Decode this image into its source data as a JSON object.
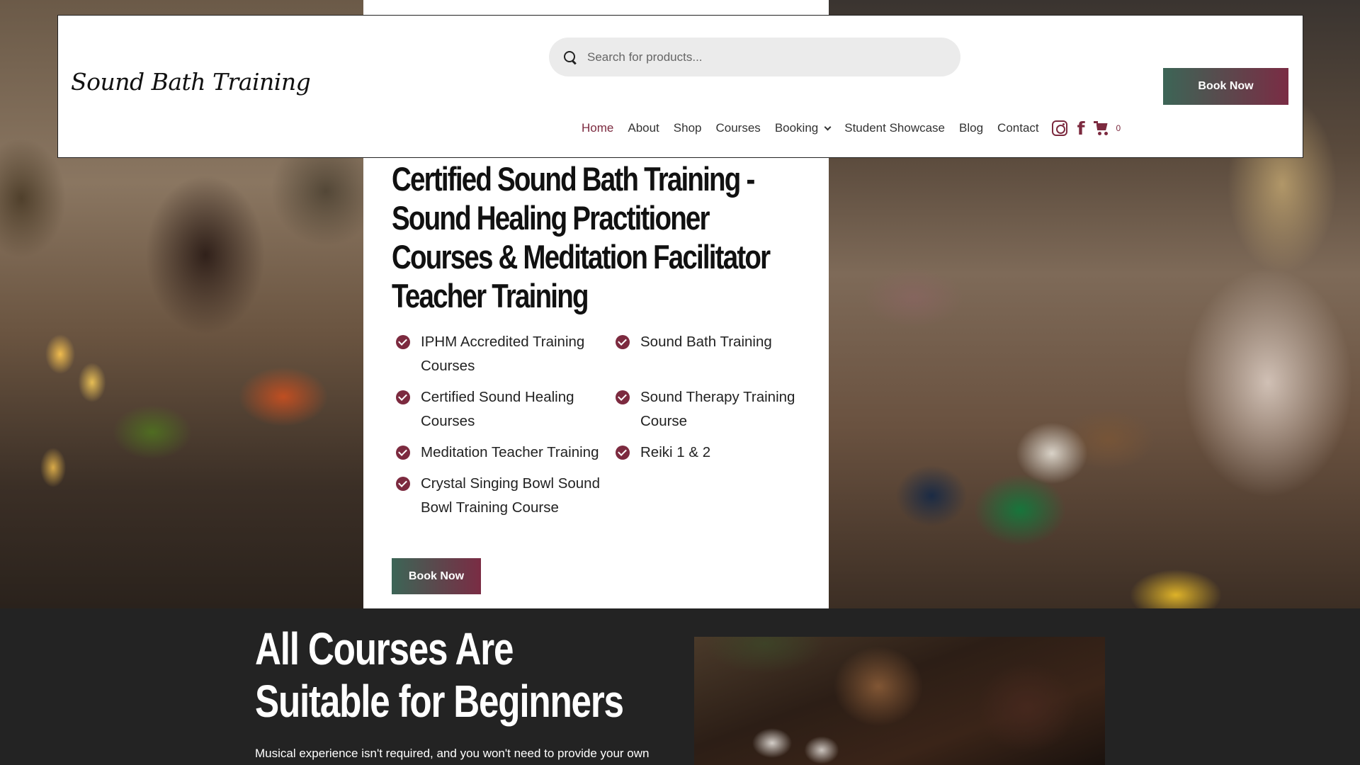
{
  "header": {
    "logo": "Sound Bath Training",
    "search_placeholder": "Search for products...",
    "book_now": "Book Now",
    "nav": [
      "Home",
      "About",
      "Shop",
      "Courses",
      "Booking",
      "Student Showcase",
      "Blog",
      "Contact"
    ],
    "cart_count": "0"
  },
  "hero": {
    "title": "Certified Sound Bath Training - Sound Healing Practitioner Courses & Meditation Facilitator Teacher Training",
    "features_left": [
      "IPHM Accredited Training Courses",
      "Certified Sound Healing Courses",
      "Meditation Teacher Training",
      "Crystal Singing Bowl Sound Bowl Training Course"
    ],
    "features_right": [
      "Sound Bath Training",
      "Sound Therapy Training Course",
      "Reiki 1 & 2"
    ],
    "book_now": "Book Now"
  },
  "lower": {
    "title_line1": "All Courses Are",
    "title_line2": "Suitable for Beginners",
    "text": "Musical experience isn't required, and you won't need to provide your own"
  },
  "colors": {
    "accent": "#7c2a3f",
    "button_gradient_start": "#3c6556",
    "button_gradient_end": "#7a2c44",
    "dark_section": "#232323"
  }
}
